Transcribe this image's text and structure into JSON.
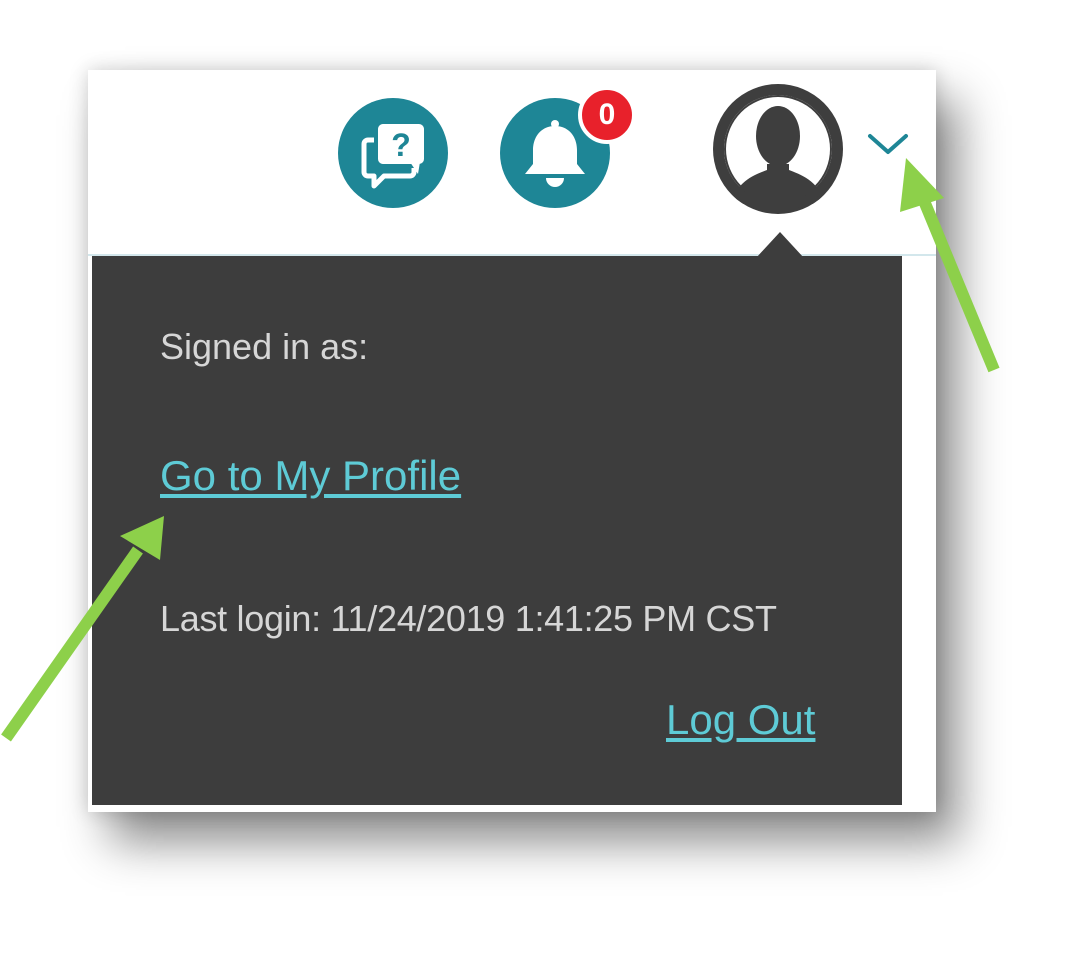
{
  "header": {
    "help_icon": "chat-question-icon",
    "notifications_icon": "bell-icon",
    "notification_count": "0",
    "avatar_icon": "user-silhouette-icon",
    "dropdown_icon": "chevron-down-icon"
  },
  "menu": {
    "signed_in_label": "Signed in as:",
    "profile_link": "Go to My Profile",
    "last_login": "Last login: 11/24/2019 1:41:25 PM CST",
    "logout_link": "Log Out"
  },
  "colors": {
    "teal_icon_bg": "#1e8696",
    "badge_red": "#e8212b",
    "menu_bg": "#3d3d3d",
    "link": "#5ecbd6",
    "annotation_arrow": "#8dd04a"
  }
}
